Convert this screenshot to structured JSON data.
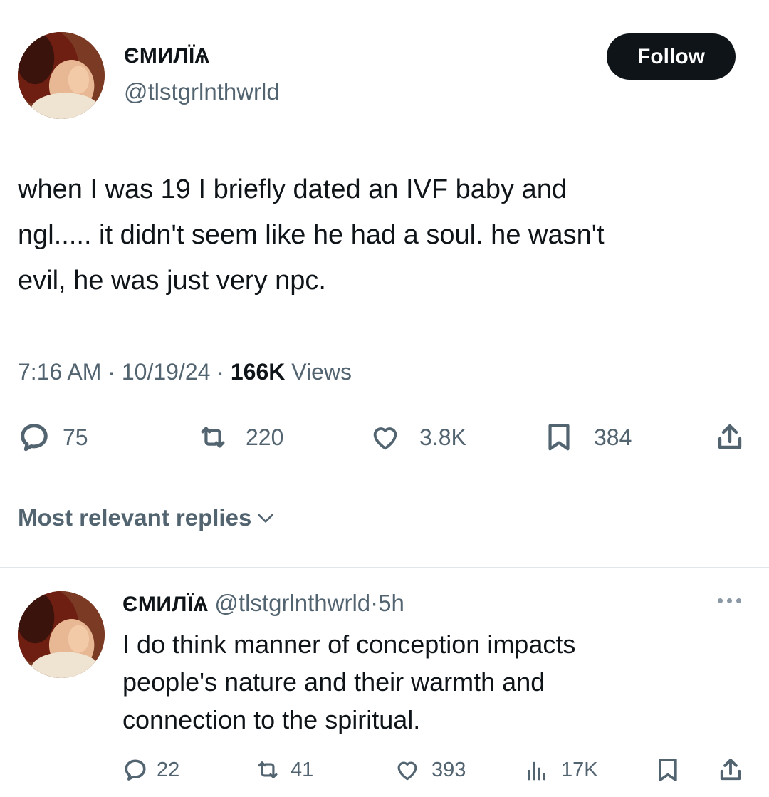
{
  "tweet": {
    "author": {
      "display_name": "ЄМИЛЇѦ",
      "handle": "@tlstgrlnthwrld"
    },
    "follow_label": "Follow",
    "text_lines": [
      "when I was 19 I briefly dated an IVF baby and",
      "ngl..... it didn't seem like he had a soul. he wasn't",
      "evil, he was just very npc."
    ],
    "time": "7:16 AM",
    "date": "10/19/24",
    "views_count": "166K",
    "views_label": "Views",
    "separator": "·",
    "stats": {
      "replies": "75",
      "reposts": "220",
      "likes": "3.8K",
      "bookmarks": "384"
    }
  },
  "replies_section": {
    "sort_label": "Most relevant replies"
  },
  "reply": {
    "author": {
      "display_name": "ЄМИЛЇѦ",
      "handle": "@tlstgrlnthwrld"
    },
    "age": "5h",
    "text_lines": [
      "I do think manner of conception impacts",
      "people's nature and their warmth and",
      "connection to the spiritual."
    ],
    "stats": {
      "replies": "22",
      "reposts": "41",
      "likes": "393",
      "views": "17K"
    }
  },
  "colors": {
    "text": "#0f1419",
    "muted": "#536471",
    "button_bg": "#0f1419",
    "divider": "#e1e6ea"
  }
}
